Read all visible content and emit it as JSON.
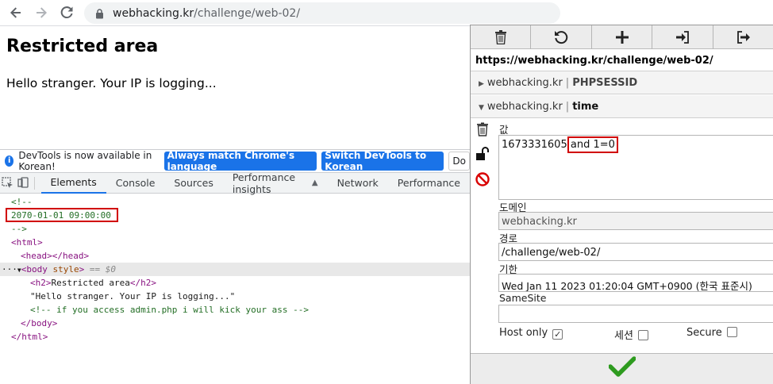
{
  "browser": {
    "url_host": "webhacking.kr",
    "url_path": "/challenge/web-02/"
  },
  "page": {
    "title": "Restricted area",
    "text": "Hello stranger. Your IP is logging..."
  },
  "devtools": {
    "infobar": {
      "message": "DevTools is now available in Korean!",
      "btn_match": "Always match Chrome's language",
      "btn_switch": "Switch DevTools to Korean",
      "btn_dont": "Do"
    },
    "tabs": [
      "Elements",
      "Console",
      "Sources",
      "Performance insights",
      "Network",
      "Performance"
    ],
    "tree": {
      "comment_open": "<!--",
      "comment_value": "2070-01-01 09:00:00",
      "comment_close": "-->",
      "html_open": "<html>",
      "head": "<head></head>",
      "body_open": "<body",
      "body_attr": "style",
      "body_close_bracket": ">",
      "body_eq": "== $0",
      "h2_open": "<h2>",
      "h2_text": "Restricted area",
      "h2_close": "</h2>",
      "body_text": "\"Hello stranger. Your IP is logging...\"",
      "hidden_comment": "<!-- if you access admin.php i will kick your ass -->",
      "body_end": "</body>",
      "html_end": "</html>"
    }
  },
  "cookie_editor": {
    "url": "https://webhacking.kr/challenge/web-02/",
    "cookies": [
      {
        "domain": "webhacking.kr",
        "name": "PHPSESSID"
      },
      {
        "domain": "webhacking.kr",
        "name": "time"
      }
    ],
    "labels": {
      "value": "값",
      "domain": "도메인",
      "path": "경로",
      "expires": "기한",
      "samesite": "SameSite",
      "host_only": "Host only",
      "session": "세션",
      "secure": "Secure"
    },
    "value_part1": "1673331605",
    "value_part2": "and 1=0",
    "domain_value": "webhacking.kr",
    "path_value": "/challenge/web-02/",
    "expires_value": "Wed Jan 11 2023 01:20:04 GMT+0900 (한국 표준시)",
    "samesite_value": "",
    "host_only_checked": true,
    "session_checked": false,
    "secure_checked": false
  }
}
